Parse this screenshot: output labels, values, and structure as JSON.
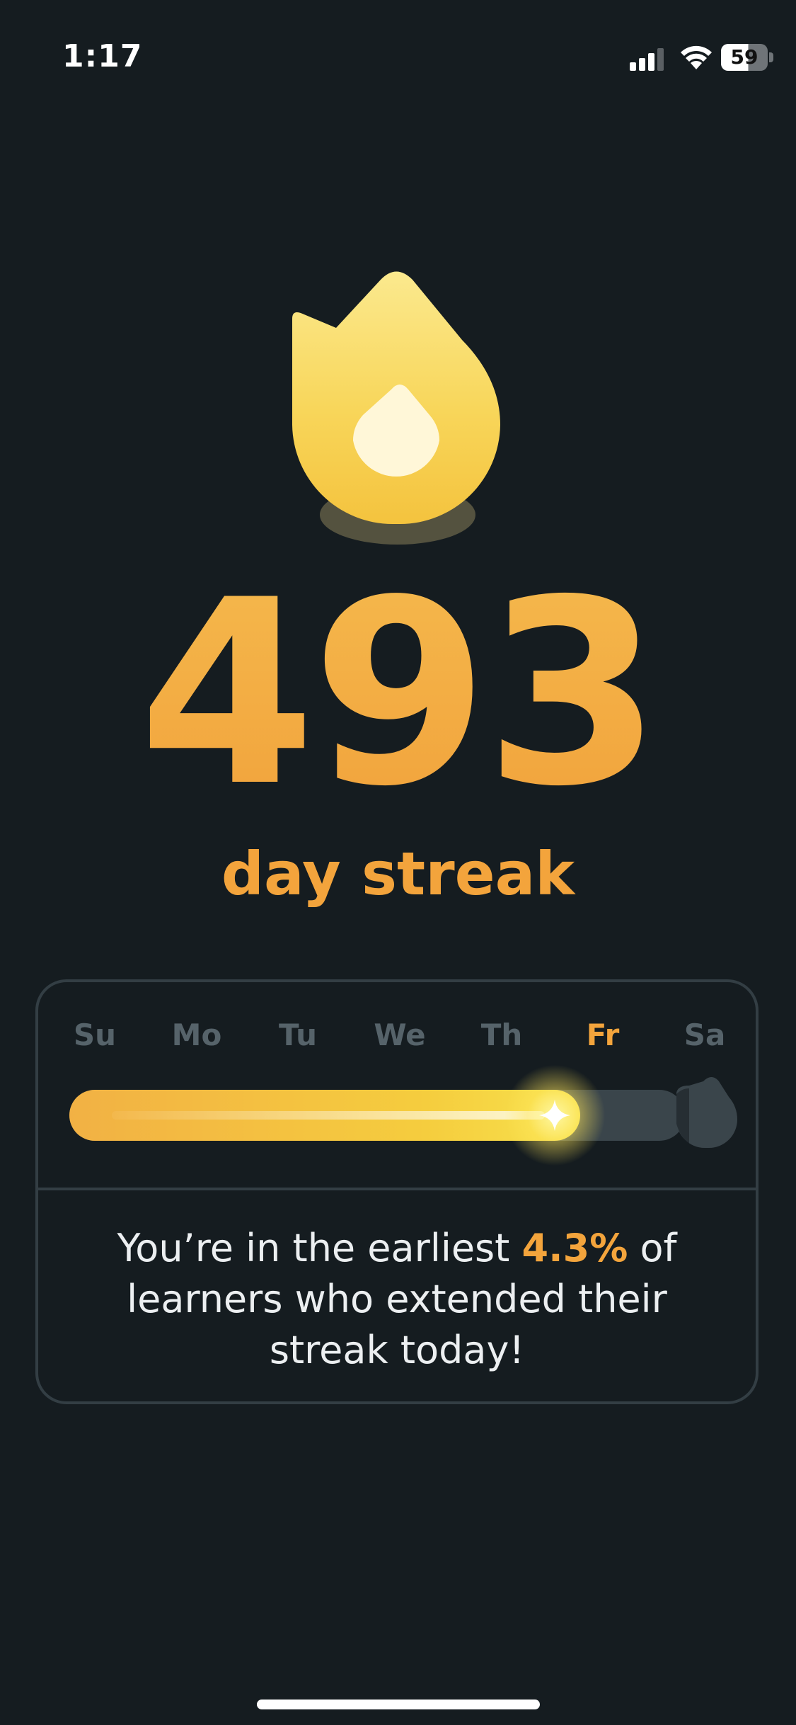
{
  "status_bar": {
    "time": "1:17",
    "battery": "59",
    "icons": [
      "cellular-signal-icon",
      "wifi-icon",
      "battery-icon"
    ]
  },
  "streak": {
    "count": "493",
    "label": "day streak",
    "icon": "flame-icon"
  },
  "week": {
    "days": [
      "Su",
      "Mo",
      "Tu",
      "We",
      "Th",
      "Fr",
      "Sa"
    ],
    "current_day_index": 5,
    "progress_fraction": 0.83
  },
  "message": {
    "before": "You’re in the earliest ",
    "highlight": "4.3%",
    "after": " of learners who extended their streak today!"
  },
  "colors": {
    "background": "#151c20",
    "accent": "#f3a43c",
    "flame_yellow": "#f7d04a",
    "card_border": "#333e44",
    "inactive_text": "#56636a"
  }
}
